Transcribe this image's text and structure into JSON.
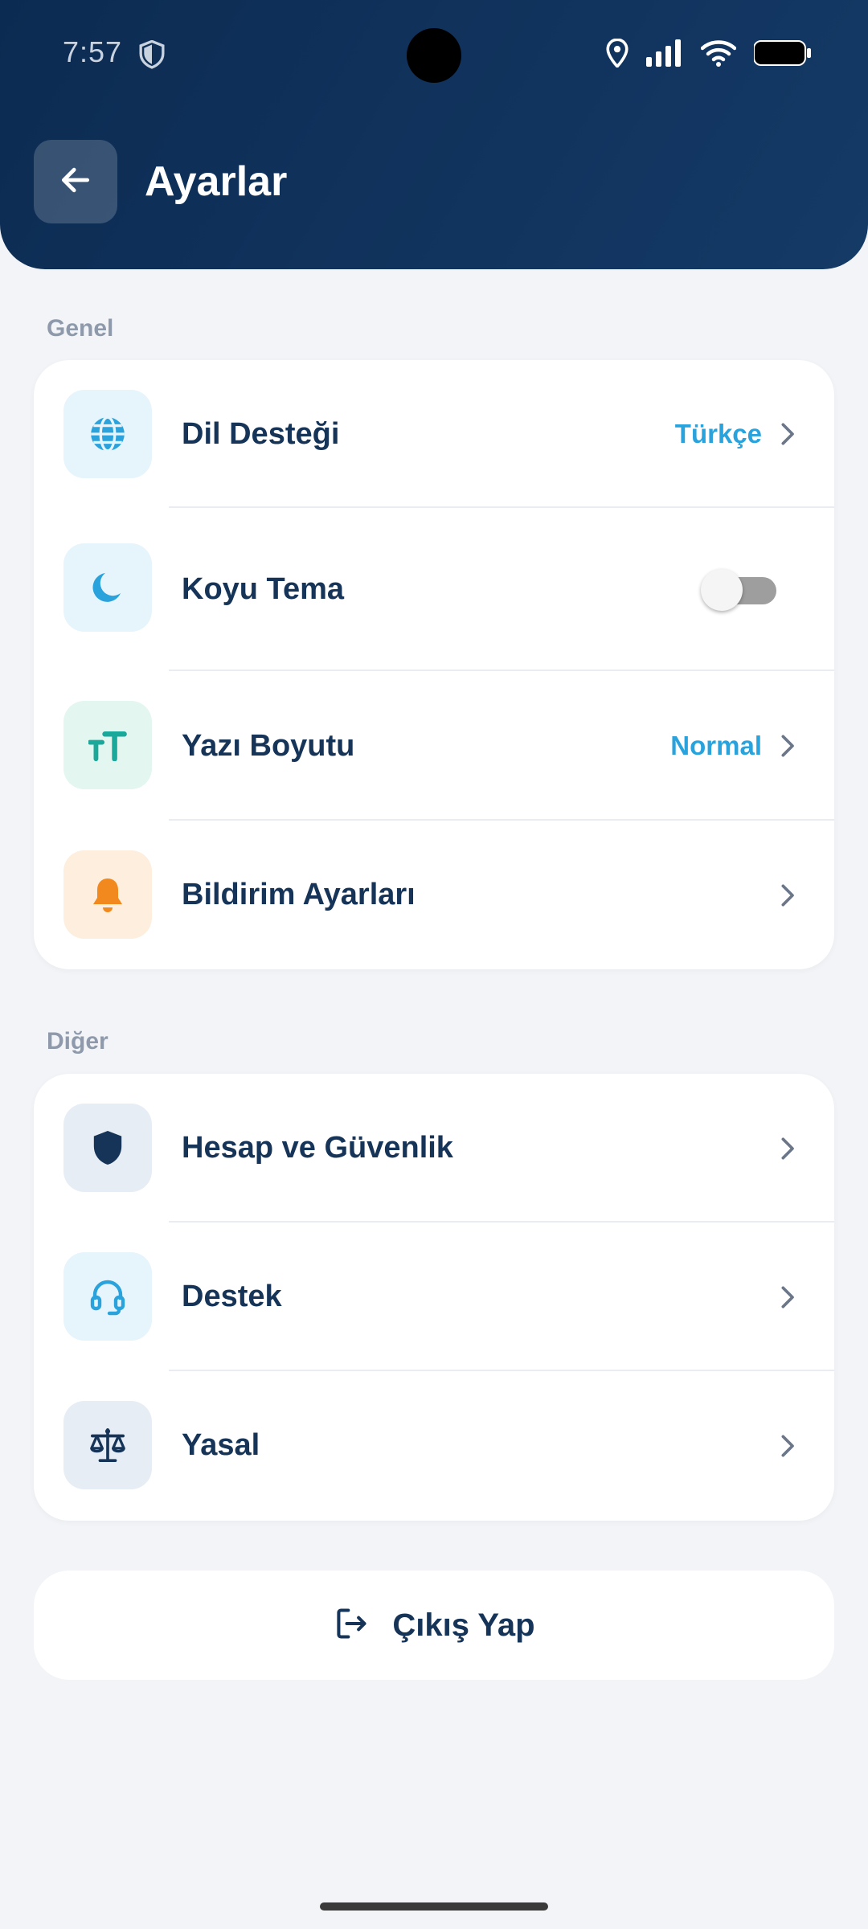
{
  "status_bar": {
    "time": "7:57"
  },
  "header": {
    "title": "Ayarlar"
  },
  "sections": {
    "general": {
      "label": "Genel",
      "items": [
        {
          "label": "Dil Desteği",
          "value": "Türkçe",
          "icon": "globe-icon"
        },
        {
          "label": "Koyu Tema",
          "toggle_on": false,
          "icon": "moon-icon"
        },
        {
          "label": "Yazı Boyutu",
          "value": "Normal",
          "icon": "text-size-icon"
        },
        {
          "label": "Bildirim Ayarları",
          "icon": "bell-icon"
        }
      ]
    },
    "other": {
      "label": "Diğer",
      "items": [
        {
          "label": "Hesap ve Güvenlik",
          "icon": "shield-icon"
        },
        {
          "label": "Destek",
          "icon": "headset-icon"
        },
        {
          "label": "Yasal",
          "icon": "scale-icon"
        }
      ]
    }
  },
  "logout": {
    "label": "Çıkış Yap",
    "icon": "logout-icon"
  },
  "colors": {
    "header_bg": "#0c2b52",
    "text_primary": "#163457",
    "accent_blue": "#2aa3dd",
    "accent_teal": "#1aa89a",
    "accent_orange": "#f2891e",
    "page_bg": "#f2f4f7"
  }
}
